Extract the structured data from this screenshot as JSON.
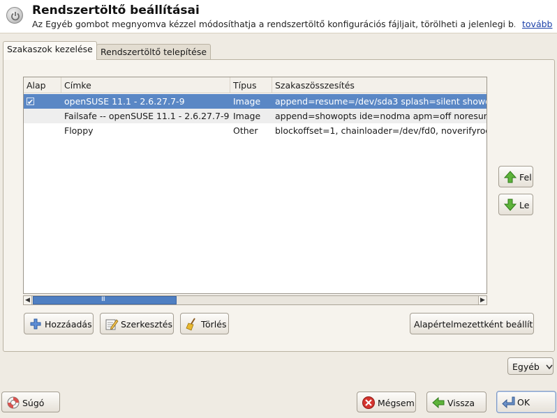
{
  "header": {
    "title": "Rendszertöltő beállításai",
    "description": "Az Egyéb gombot megnyomva kézzel módosíthatja a rendszertöltő konfigurációs fájljait, törölheti a jelenlegi b...",
    "more_link": "tovább"
  },
  "tabs": [
    {
      "label": "Szakaszok kezelése",
      "active": true
    },
    {
      "label": "Rendszertöltő telepítése",
      "active": false
    }
  ],
  "table": {
    "columns": [
      "Alap",
      "Címke",
      "Típus",
      "Szakaszösszesítés"
    ],
    "rows": [
      {
        "default": "✔",
        "label": "openSUSE 11.1 - 2.6.27.7-9",
        "type": "Image",
        "summary": "append=resume=/dev/sda3 splash=silent showo",
        "selected": true
      },
      {
        "default": "",
        "label": "Failsafe -- openSUSE 11.1 - 2.6.27.7-9",
        "type": "Image",
        "summary": "append=showopts ide=nodma apm=off noresun",
        "selected": false
      },
      {
        "default": "",
        "label": "Floppy",
        "type": "Other",
        "summary": "blockoffset=1, chainloader=/dev/fd0, noverifyroo",
        "selected": false
      }
    ],
    "scroll_grip": "III"
  },
  "side_buttons": {
    "up": "Fel",
    "down": "Le"
  },
  "actions": {
    "add": "Hozzáadás",
    "edit": "Szerkesztés",
    "delete": "Törlés",
    "set_default": "Alapértelmezettként beállít"
  },
  "other_menu": {
    "label": "Egyéb",
    "icon": "chevron-down-icon"
  },
  "footer": {
    "help": "Súgó",
    "cancel": "Mégsem",
    "back": "Vissza",
    "ok": "OK"
  },
  "colors": {
    "selection": "#5a87c5",
    "window_bg": "#efebe3",
    "link": "#1a3fa8"
  }
}
